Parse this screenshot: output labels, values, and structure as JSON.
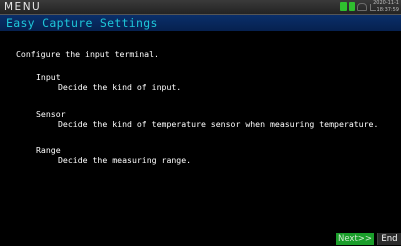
{
  "menu": {
    "title": "MENU",
    "date": "2020-11-1",
    "time": "18:37:59"
  },
  "status_icons": [
    "battery-icon",
    "memory-card-icon",
    "cloud-icon",
    "signal-icon"
  ],
  "screen_title": "Easy Capture Settings",
  "content": {
    "intro": "Configure the input terminal.",
    "items": [
      {
        "heading": "Input",
        "description": "Decide the kind of input."
      },
      {
        "heading": "Sensor",
        "description": "Decide the kind of temperature sensor when measuring temperature."
      },
      {
        "heading": "Range",
        "description": "Decide the measuring range."
      }
    ]
  },
  "buttons": {
    "next_label": "Next>>",
    "end_label": "End"
  },
  "colors": {
    "title_text": "#1ec7d9",
    "title_bar": "#0a2f6a",
    "next_button": "#1a9e2a",
    "status_green": "#2fbf2f"
  }
}
